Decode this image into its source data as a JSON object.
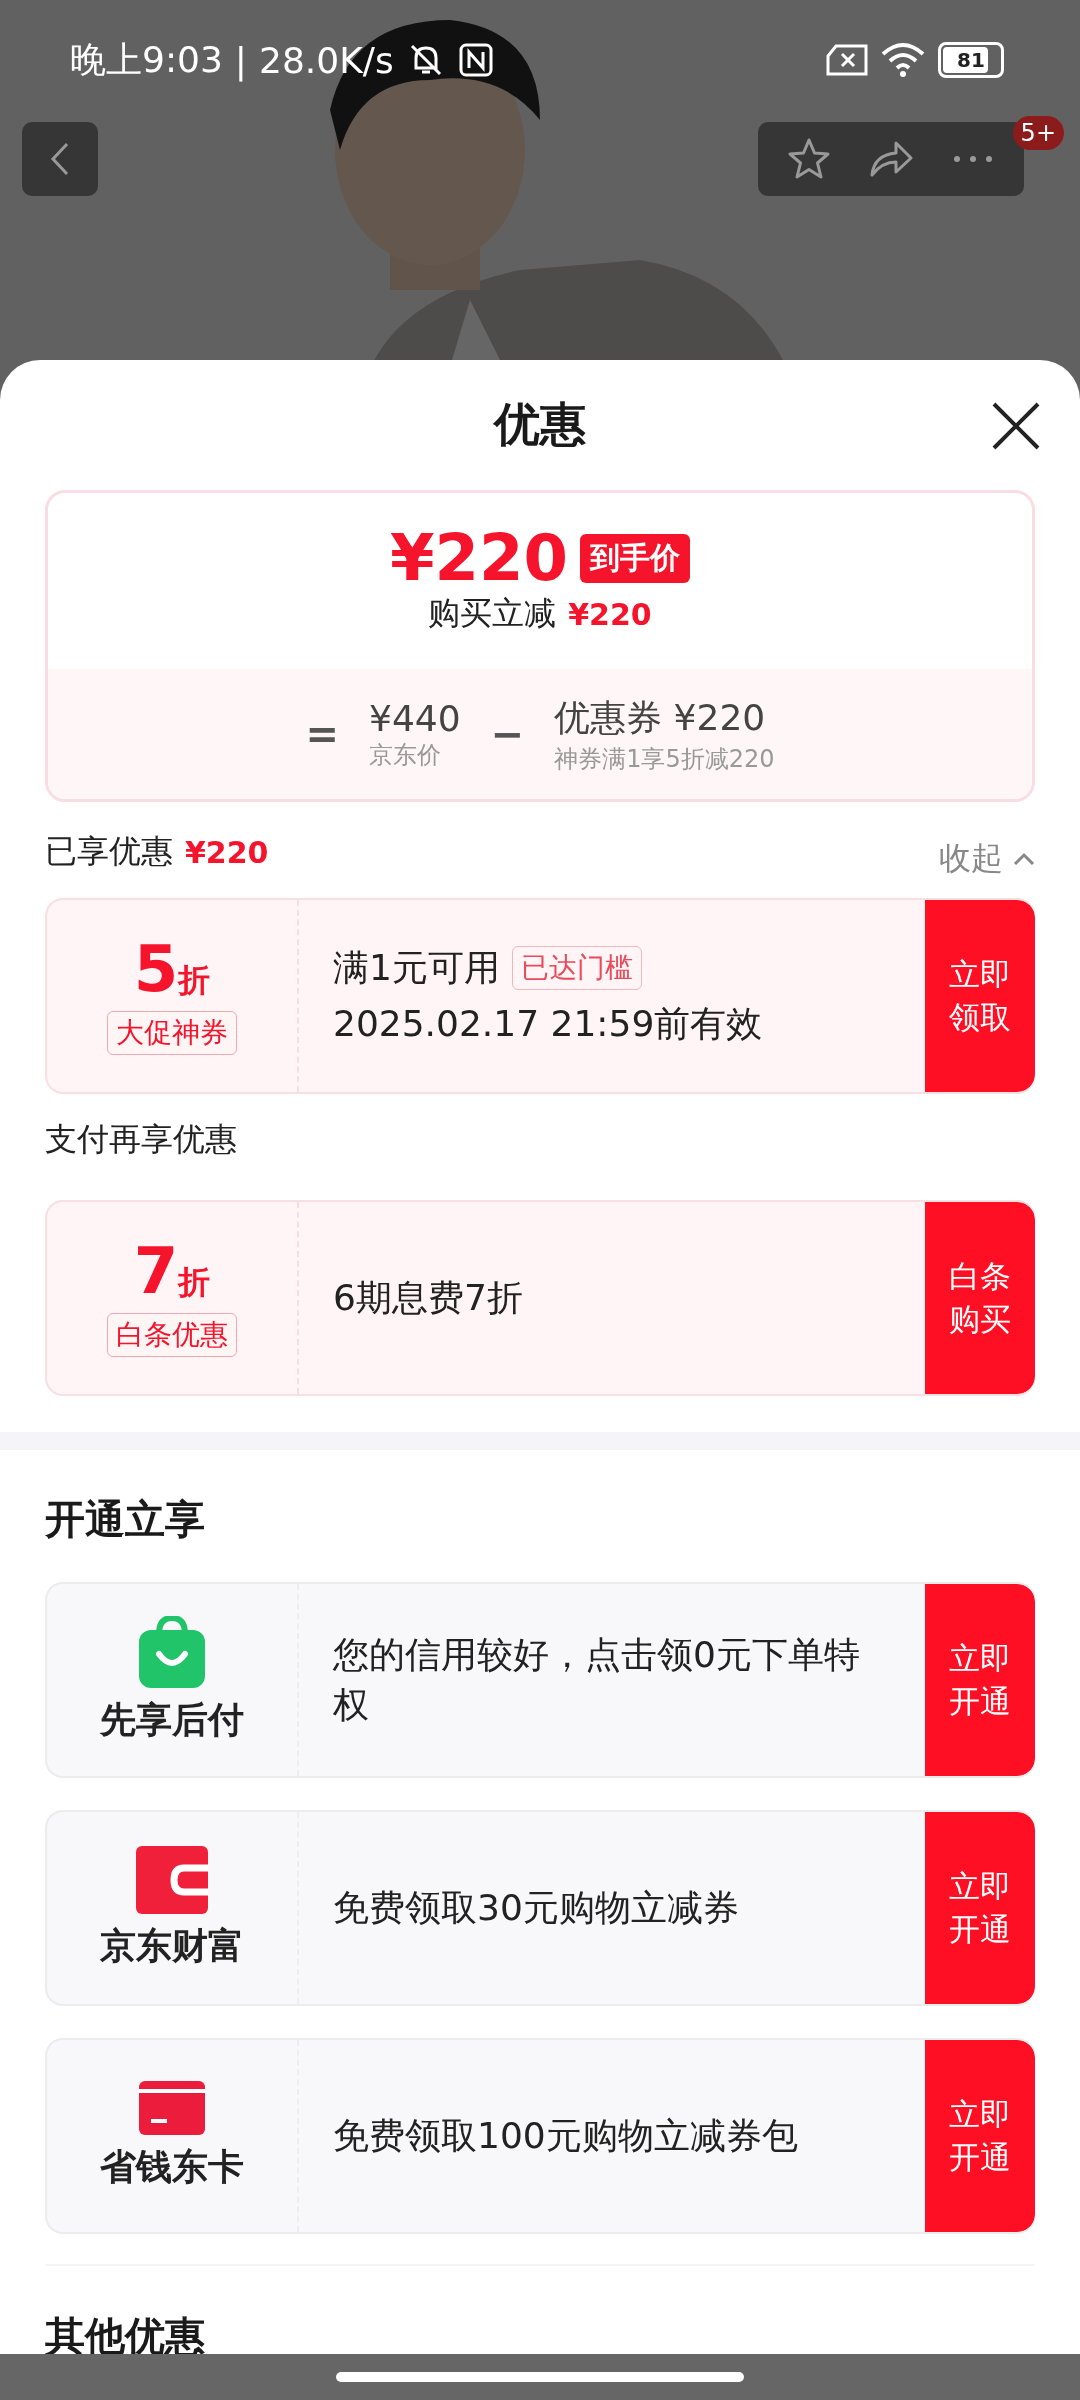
{
  "status_bar": {
    "time": "晚上9:03",
    "separator": "|",
    "speed": "28.0K/s",
    "battery": "81"
  },
  "top_bar": {
    "badge": "5+"
  },
  "sheet": {
    "title": "优惠"
  },
  "summary": {
    "final_price": "¥220",
    "final_tag": "到手价",
    "saving_label": "购买立减",
    "saving_amount": "¥220",
    "equals": "=",
    "base_price": "¥440",
    "base_label": "京东价",
    "minus": "−",
    "coupon_label": "优惠券 ¥220",
    "coupon_note": "神券满1享5折减220"
  },
  "enjoyed": {
    "label": "已享优惠",
    "amount": "¥220",
    "toggle": "收起",
    "expanded": true
  },
  "coupons": [
    {
      "discount": "5",
      "unit": "折",
      "tag": "大促神券",
      "condition": "满1元可用",
      "badge": "已达门槛",
      "validity": "2025.02.17 21:59前有效",
      "action": "立即领取"
    }
  ],
  "payment": {
    "title": "支付再享优惠",
    "coupons": [
      {
        "discount": "7",
        "unit": "折",
        "tag": "白条优惠",
        "condition": "6期息费7折",
        "action": "白条购买"
      }
    ]
  },
  "open": {
    "title": "开通立享",
    "items": [
      {
        "kind": "bag",
        "name": "先享后付",
        "text": "您的信用较好，点击领0元下单特权",
        "action": "立即开通"
      },
      {
        "kind": "wallet",
        "name": "京东财富",
        "text": "免费领取30元购物立减券",
        "action": "立即开通"
      },
      {
        "kind": "card",
        "name": "省钱东卡",
        "text": "免费领取100元购物立减券包",
        "action": "立即开通"
      }
    ]
  },
  "other": {
    "title": "其他优惠"
  }
}
